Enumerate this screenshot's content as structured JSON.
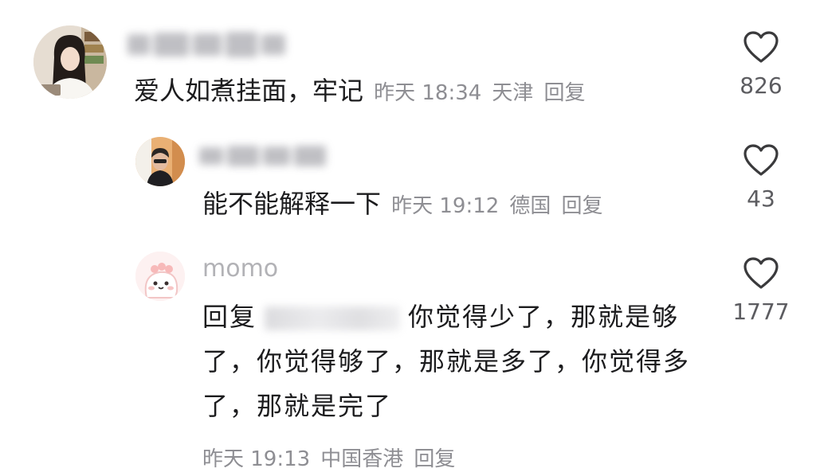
{
  "comments": [
    {
      "text": "爱人如煮挂面，牢记",
      "time": "昨天 18:34",
      "location": "天津",
      "reply_label": "回复",
      "likes": "826",
      "avatar_icon": "user-avatar-woman"
    },
    {
      "text": "能不能解释一下",
      "time": "昨天 19:12",
      "location": "德国",
      "reply_label": "回复",
      "likes": "43",
      "avatar_icon": "user-avatar-man"
    },
    {
      "username": "momo",
      "reply_prefix": "回复",
      "text_line1": "你觉得少了，那就是",
      "text_rest": "够了，你觉得够了，那就是多了，你觉得多了，那就是完了",
      "time": "昨天 19:13",
      "location": "中国香港",
      "reply_label": "回复",
      "likes": "1777",
      "avatar_icon": "cartoon-dinosaur-avatar"
    }
  ],
  "colors": {
    "text": "#1c1c1e",
    "meta": "#8e8e93",
    "username": "#b2b2b6",
    "heart": "#3a3a3c"
  },
  "icons": {
    "like": "heart-outline-icon"
  }
}
